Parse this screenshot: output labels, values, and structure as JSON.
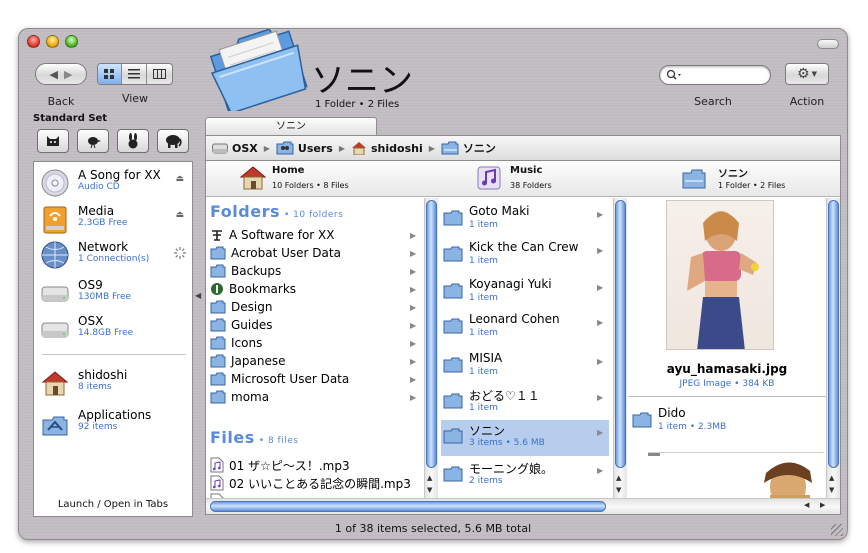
{
  "toolbar": {
    "back_label": "Back",
    "view_label": "View",
    "search_label": "Search",
    "action_label": "Action"
  },
  "title": {
    "name": "ソニン",
    "summary": "1 Folder • 2 Files"
  },
  "standard_set": {
    "label": "Standard Set",
    "buttons": [
      "cat",
      "bird",
      "rabbit",
      "elephant"
    ]
  },
  "sidebar": {
    "items": [
      {
        "name": "A Song for XX",
        "sub": "Audio CD",
        "icon": "cd-icon",
        "eject": true
      },
      {
        "name": "Media",
        "sub": "2.3GB Free",
        "icon": "firewire-drive-icon",
        "eject": true
      },
      {
        "name": "Network",
        "sub": "1 Connection(s)",
        "icon": "network-globe-icon",
        "eject": false
      },
      {
        "name": "OS9",
        "sub": "130MB Free",
        "icon": "hard-drive-icon",
        "eject": false
      },
      {
        "name": "OSX",
        "sub": "14.8GB Free",
        "icon": "hard-drive-icon",
        "eject": false
      }
    ],
    "places": [
      {
        "name": "shidoshi",
        "sub": "8 items",
        "icon": "home-icon"
      },
      {
        "name": "Applications",
        "sub": "92 items",
        "icon": "applications-icon"
      }
    ],
    "footer": "Launch / Open in Tabs"
  },
  "tab": {
    "label": "ソニン"
  },
  "path": [
    "OSX",
    "Users",
    "shidoshi",
    "ソニン"
  ],
  "columns": {
    "home": {
      "name": "Home",
      "sub": "10 Folders • 8 Files"
    },
    "music": {
      "name": "Music",
      "sub": "38 Folders"
    },
    "sonin": {
      "name": "ソニン",
      "sub": "1 Folder • 2 Files"
    }
  },
  "home_column": {
    "folders_title": "Folders",
    "folders_count": "• 10 folders",
    "folders": [
      "A Software for XX",
      "Acrobat User Data",
      "Backups",
      "Bookmarks",
      "Design",
      "Guides",
      "Icons",
      "Japanese",
      "Microsoft User Data",
      "moma"
    ],
    "files_title": "Files",
    "files_count": "• 8 files",
    "files": [
      "01 ザ☆ピ〜ス！.mp3",
      "02 いいことある記念の瞬間.mp3"
    ]
  },
  "music_column": {
    "items": [
      {
        "name": "Goto Maki",
        "sub": "1 item"
      },
      {
        "name": "Kick the Can Crew",
        "sub": "1 item"
      },
      {
        "name": "Koyanagi Yuki",
        "sub": "1 item"
      },
      {
        "name": "Leonard Cohen",
        "sub": "1 item"
      },
      {
        "name": "MISIA",
        "sub": "1 item"
      },
      {
        "name": "おどる♡１１",
        "sub": "1 item"
      },
      {
        "name": "ソニン",
        "sub": "3 items • 5.6 MB"
      },
      {
        "name": "モーニング娘。",
        "sub": "2 items"
      }
    ]
  },
  "preview": {
    "filename": "ayu_hamasaki.jpg",
    "info": "JPEG Image • 384 KB",
    "folder_name": "Dido",
    "folder_sub": "1 item • 2.3MB"
  },
  "status_bar": "1 of 38 items selected, 5.6 MB total",
  "colors": {
    "accent_blue": "#3b6fd1",
    "selection": "#b7cdee",
    "section_title": "#5b8ad8"
  }
}
